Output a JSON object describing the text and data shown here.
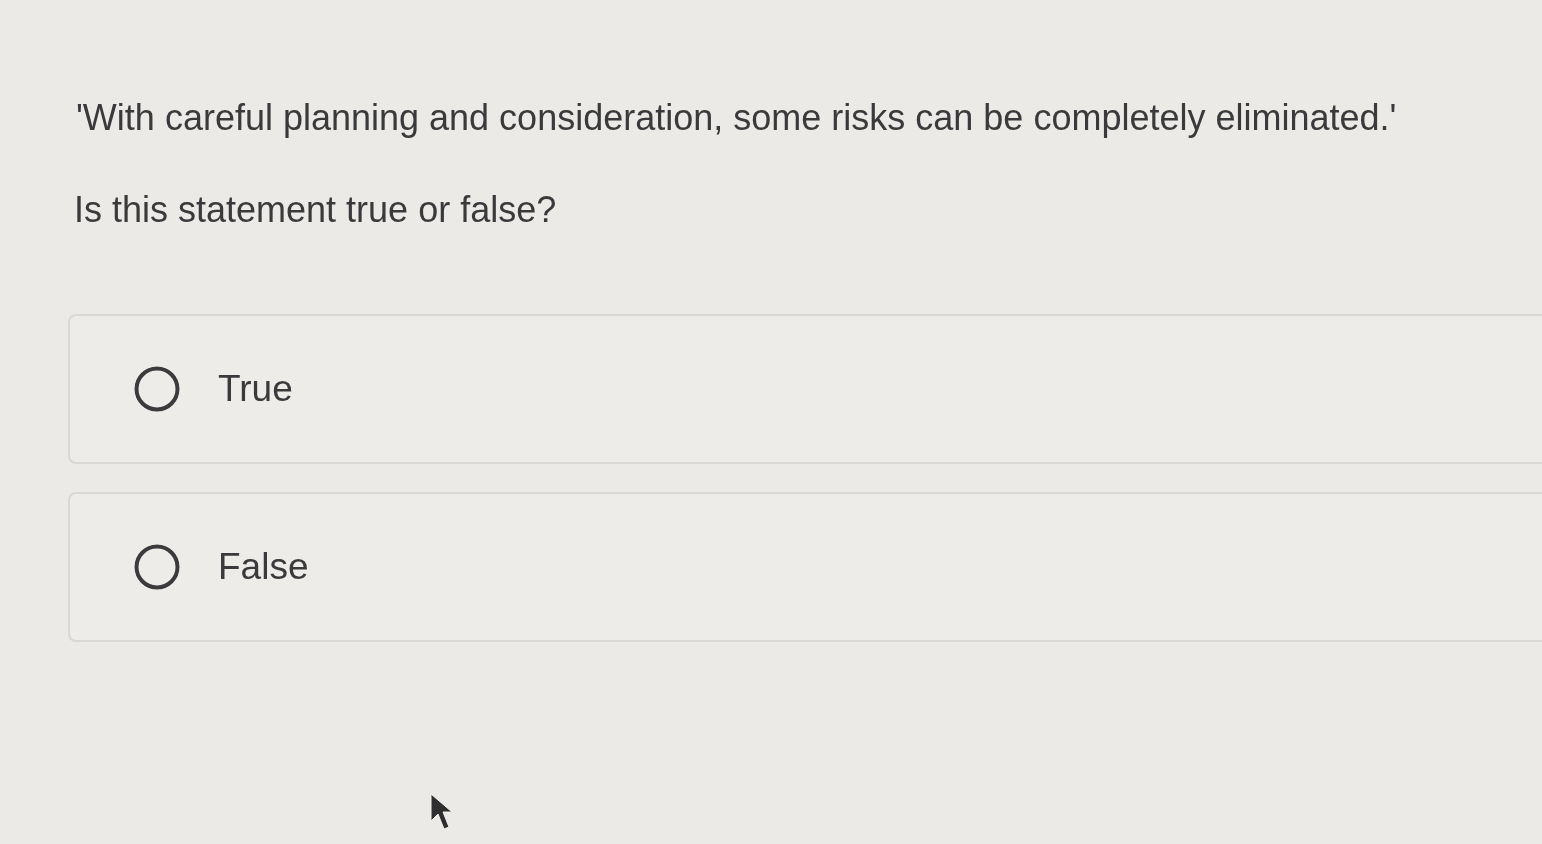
{
  "question": {
    "statement": "'With careful planning and consideration, some risks can be completely eliminated.'",
    "prompt": "Is this statement true or false?"
  },
  "options": [
    {
      "label": "True",
      "selected": false
    },
    {
      "label": "False",
      "selected": false
    }
  ]
}
